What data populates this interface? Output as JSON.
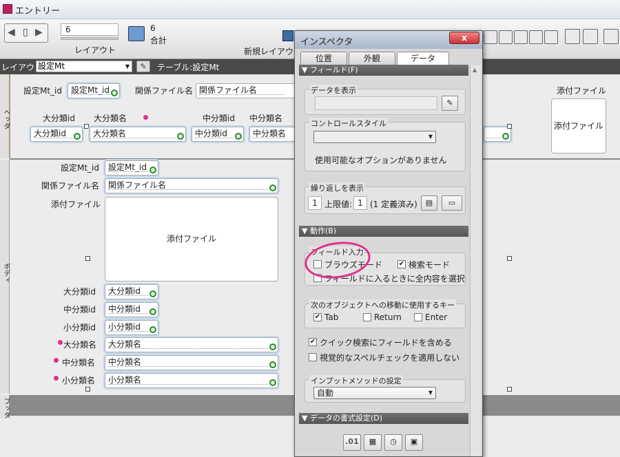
{
  "window": {
    "title": "エントリー"
  },
  "toolbar": {
    "record_value": "6",
    "layout_label": "レイアウト",
    "count": "6",
    "count_label": "合計",
    "new_layout_label": "新規レイアウ"
  },
  "layoutbar": {
    "prefix": "レイアウト:",
    "layout_name": "設定Mt",
    "table": "テーブル:設定Mt"
  },
  "header": {
    "ruler": "ヘッダ",
    "fields": [
      {
        "label": "設定Mt_id",
        "value": "設定Mt_id"
      },
      {
        "label": "関係ファイル名",
        "value": "関係ファイル名"
      },
      {
        "label": "大分類id",
        "value": "大分類id"
      },
      {
        "label": "大分類名",
        "value": "大分類名"
      },
      {
        "label": "中分類id",
        "value": "中分類id"
      },
      {
        "label": "中分類名",
        "value": "中分類名"
      },
      {
        "label": "添付ファイル",
        "value": "添付ファイル"
      }
    ]
  },
  "body": {
    "ruler": "ボディ",
    "fields": [
      {
        "label": "設定Mt_id",
        "value": "設定Mt_id"
      },
      {
        "label": "関係ファイル名",
        "value": "関係ファイル名"
      },
      {
        "label": "添付ファイル",
        "value": "添付ファイル"
      },
      {
        "label": "大分類id",
        "value": "大分類id"
      },
      {
        "label": "中分類id",
        "value": "中分類id"
      },
      {
        "label": "小分類id",
        "value": "小分類id"
      },
      {
        "label": "大分類名",
        "value": "大分類名"
      },
      {
        "label": "中分類名",
        "value": "中分類名"
      },
      {
        "label": "小分類名",
        "value": "小分類名"
      }
    ]
  },
  "footer": {
    "ruler": "フッタ"
  },
  "inspector": {
    "title": "インスペクタ",
    "close": "x",
    "tabs": [
      "位置",
      "外観",
      "データ"
    ],
    "active_tab": "データ",
    "field_section": "フィールド(F)",
    "display_data": "データを表示",
    "control_style": "コントロールスタイル",
    "no_options": "使用可能なオプションがありません",
    "repeat_label": "繰り返しを表示",
    "repeat_from": "1",
    "repeat_max_label": "上限値:",
    "repeat_max": "1",
    "repeat_defined": "(1 定義済み)",
    "behavior_section": "動作(B)",
    "field_entry": "フィールド入力",
    "browse_mode": "ブラウズモード",
    "browse_checked": false,
    "find_mode": "検索モード",
    "find_checked": true,
    "select_all": "フィールドに入るときに全内容を選択",
    "nav_keys": "次のオブジェクトへの移動に使用するキー",
    "key_tab": "Tab",
    "key_return": "Return",
    "key_enter": "Enter",
    "tab_checked": true,
    "quick_find": "クイック検索にフィールドを含める",
    "quick_checked": true,
    "no_spell": "視覚的なスペルチェックを適用しない",
    "input_method": "インプットメソッドの設定",
    "input_value": "自動",
    "format_section": "データの書式設定(D)",
    "format_number": ".01"
  },
  "colors": {
    "highlight": "#e0308a",
    "zoom": "#2a8a2a"
  }
}
